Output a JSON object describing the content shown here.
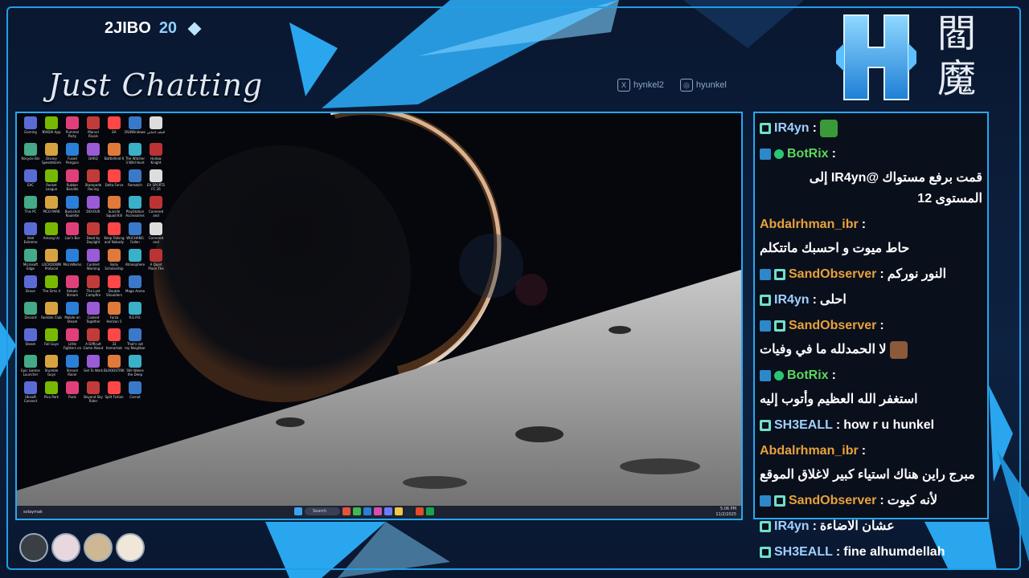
{
  "stream": {
    "channel": "2JIBO",
    "count": "20",
    "category": "Just Chatting",
    "socials": [
      {
        "icon": "x-icon",
        "label": "hynkel2"
      },
      {
        "icon": "instagram-icon",
        "label": "hyunkel"
      }
    ],
    "logo_letter": "H",
    "kanji_top": "閻",
    "kanji_bottom": "魔"
  },
  "desktop": {
    "icons": [
      "Gaming",
      "NVIDIA App",
      "Pummel Party",
      "Marvel Rivals",
      "EA",
      "DS4Windows",
      "الملف الخاص",
      "Recycle Bin",
      "Disney Speedstorm",
      "Fused Penguin",
      "DARQ",
      "Battlefield 6",
      "The Witcher 3 Wild Hunt",
      "Hollow Knight",
      "EAC",
      "Rocket League",
      "Rubber Bandits",
      "Stampede Racing",
      "Delta Force",
      "Rematch",
      "EA SPORTS FC 26",
      "This PC",
      "PICO PARK",
      "Buckshot Roulette",
      "DEVOUR",
      "Suicide Squad Kill",
      "PlayStation Accessories",
      "Cornered and Conquered",
      "Intel Extreme",
      "Among Us",
      "Liar's Bar",
      "Dead by Daylight",
      "Keep Talking and Nobody",
      "WUCHANG Fallen Feathers",
      "Cornered and Conquered",
      "Microsoft Edge",
      "LOCKDOWN Protocol",
      "MicroWorks",
      "Content Warning",
      "Bully Scholarship",
      "Atmosphere",
      "A Quiet Place The Road",
      "Brave",
      "The Sims 4",
      "Kebalo Stream",
      "The Last Campfire",
      "Double Shoulders",
      "Mage Arena",
      "",
      "Discord",
      "Rumble Club",
      "Mobile on Steam",
      "Cooked Together",
      "Forza Horizon 5",
      "R.E.P.O.",
      "",
      "Steam",
      "Fall Guys",
      "Little Fighters on Steam",
      "A Difficult Game About",
      "33 Immortals",
      "That's not my Neighbor",
      "",
      "Epic Games Launcher",
      "Stumble Guys",
      "Stream Racer",
      "Get To Work",
      "BLOODSTRIKE",
      "Still Wakes the Deep",
      "",
      "Ubisoft Connect",
      "Pico Park",
      "Punk",
      "Beyond Sky Rider",
      "Split Fiction",
      "Cornet",
      ""
    ],
    "taskbar": {
      "user": "solaymak",
      "search_placeholder": "Search",
      "time": "5:06 PM",
      "date": "11/2/2025",
      "lang": "ENG"
    }
  },
  "chat": [
    {
      "badges": [
        "cyan"
      ],
      "user": "IR4yn",
      "color": "#9fd0ff",
      "sep": " :",
      "text": "",
      "emote": "#3a9a3a"
    },
    {
      "badges": [
        "bot",
        "check"
      ],
      "user": "BotRix",
      "color": "#5cd65c",
      "sep": " : ",
      "text": "قمت برفع مستواك @IR4yn إلى المستوى 12"
    },
    {
      "badges": [],
      "user": "Abdalrhman_ibr",
      "color": "#e8a23a",
      "sep": " : ",
      "text": "حاط ميوت و احسبك ماتتكلم"
    },
    {
      "badges": [
        "bot",
        "cyan"
      ],
      "user": "SandObserver",
      "color": "#e8a23a",
      "sep": " : ",
      "text": "النور نوركم"
    },
    {
      "badges": [
        "cyan"
      ],
      "user": "IR4yn",
      "color": "#9fd0ff",
      "sep": " : ",
      "text": "احلى"
    },
    {
      "badges": [
        "bot",
        "cyan"
      ],
      "user": "SandObserver",
      "color": "#e8a23a",
      "sep": " : ",
      "text": "لا الحمدلله ما في وفيات",
      "emote": "#8a5a3a"
    },
    {
      "badges": [
        "bot",
        "check"
      ],
      "user": "BotRix",
      "color": "#5cd65c",
      "sep": " : ",
      "text": "استغفر الله العظيم وأتوب إليه"
    },
    {
      "badges": [
        "cyan"
      ],
      "user": "SH3EALL",
      "color": "#9fd0ff",
      "sep": " : ",
      "text": "how r u hunkel"
    },
    {
      "badges": [],
      "user": "Abdalrhman_ibr",
      "color": "#e8a23a",
      "sep": " : ",
      "text": "مبرج راين هناك استياء كبير لاغلاق الموقع"
    },
    {
      "badges": [
        "bot",
        "cyan"
      ],
      "user": "SandObserver",
      "color": "#e8a23a",
      "sep": " : ",
      "text": "لأنه كيوت"
    },
    {
      "badges": [
        "cyan"
      ],
      "user": "IR4yn",
      "color": "#9fd0ff",
      "sep": " : ",
      "text": "عشان الاضاءة"
    },
    {
      "badges": [
        "cyan"
      ],
      "user": "SH3EALL",
      "color": "#9fd0ff",
      "sep": " : ",
      "text": "fine alhumdellah"
    }
  ],
  "colors": {
    "accent": "#27a7ef",
    "frame": "#0b1a33"
  }
}
